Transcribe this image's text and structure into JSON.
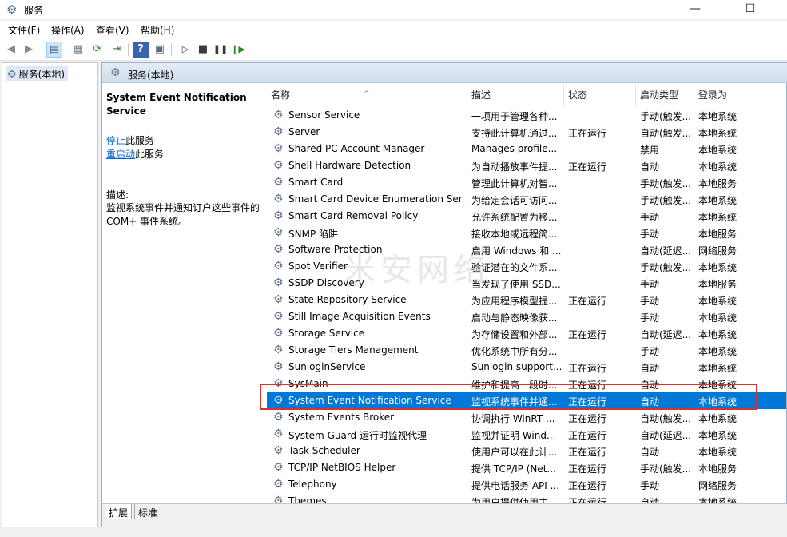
{
  "window": {
    "title": "服务",
    "minimize": "—",
    "maximize": "☐",
    "close": "✕"
  },
  "menu": [
    "文件(F)",
    "操作(A)",
    "查看(V)",
    "帮助(H)"
  ],
  "tree": {
    "label": "服务(本地)"
  },
  "main": {
    "header": "服务(本地)",
    "selected_title": "System Event Notification Service",
    "stop_link": "停止",
    "stop_suffix": "此服务",
    "restart_link": "重启动",
    "restart_suffix": "此服务",
    "desc_label": "描述:",
    "desc_text": "监视系统事件并通知订户这些事件的 COM+ 事件系统。"
  },
  "columns": {
    "name": "名称",
    "desc": "描述",
    "status": "状态",
    "start": "启动类型",
    "logon": "登录为"
  },
  "services": [
    {
      "name": "Sensor Service",
      "desc": "一项用于管理各种...",
      "status": "",
      "start": "手动(触发...",
      "logon": "本地系统"
    },
    {
      "name": "Server",
      "desc": "支持此计算机通过...",
      "status": "正在运行",
      "start": "自动(触发...",
      "logon": "本地系统"
    },
    {
      "name": "Shared PC Account Manager",
      "desc": "Manages profile...",
      "status": "",
      "start": "禁用",
      "logon": "本地系统"
    },
    {
      "name": "Shell Hardware Detection",
      "desc": "为自动播放事件提...",
      "status": "正在运行",
      "start": "自动",
      "logon": "本地系统"
    },
    {
      "name": "Smart Card",
      "desc": "管理此计算机对智...",
      "status": "",
      "start": "手动(触发...",
      "logon": "本地服务"
    },
    {
      "name": "Smart Card Device Enumeration Ser...",
      "desc": "为给定会话可访问...",
      "status": "",
      "start": "手动(触发...",
      "logon": "本地系统"
    },
    {
      "name": "Smart Card Removal Policy",
      "desc": "允许系统配置为移...",
      "status": "",
      "start": "手动",
      "logon": "本地系统"
    },
    {
      "name": "SNMP 陷阱",
      "desc": "接收本地或远程简...",
      "status": "",
      "start": "手动",
      "logon": "本地服务"
    },
    {
      "name": "Software Protection",
      "desc": "启用 Windows 和 ...",
      "status": "",
      "start": "自动(延迟...",
      "logon": "网络服务"
    },
    {
      "name": "Spot Verifier",
      "desc": "验证潜在的文件系...",
      "status": "",
      "start": "手动(触发...",
      "logon": "本地系统"
    },
    {
      "name": "SSDP Discovery",
      "desc": "当发现了使用 SSD...",
      "status": "",
      "start": "手动",
      "logon": "本地服务"
    },
    {
      "name": "State Repository Service",
      "desc": "为应用程序模型提...",
      "status": "正在运行",
      "start": "手动",
      "logon": "本地系统"
    },
    {
      "name": "Still Image Acquisition Events",
      "desc": "启动与静态映像获...",
      "status": "",
      "start": "手动",
      "logon": "本地系统"
    },
    {
      "name": "Storage Service",
      "desc": "为存储设置和外部...",
      "status": "正在运行",
      "start": "自动(延迟...",
      "logon": "本地系统"
    },
    {
      "name": "Storage Tiers Management",
      "desc": "优化系统中所有分...",
      "status": "",
      "start": "手动",
      "logon": "本地系统"
    },
    {
      "name": "SunloginService",
      "desc": "Sunlogin support...",
      "status": "正在运行",
      "start": "自动",
      "logon": "本地系统"
    },
    {
      "name": "SysMain",
      "desc": "维护和提高一段时...",
      "status": "正在运行",
      "start": "自动",
      "logon": "本地系统"
    },
    {
      "name": "System Event Notification Service",
      "desc": "监视系统事件并通...",
      "status": "正在运行",
      "start": "自动",
      "logon": "本地系统"
    },
    {
      "name": "System Events Broker",
      "desc": "协调执行 WinRT ...",
      "status": "正在运行",
      "start": "自动(触发...",
      "logon": "本地系统"
    },
    {
      "name": "System Guard 运行时监视代理",
      "desc": "监视并证明 Wind...",
      "status": "正在运行",
      "start": "自动(延迟...",
      "logon": "本地系统"
    },
    {
      "name": "Task Scheduler",
      "desc": "使用户可以在此计...",
      "status": "正在运行",
      "start": "自动",
      "logon": "本地系统"
    },
    {
      "name": "TCP/IP NetBIOS Helper",
      "desc": "提供 TCP/IP (Net...",
      "status": "正在运行",
      "start": "手动(触发...",
      "logon": "本地服务"
    },
    {
      "name": "Telephony",
      "desc": "提供电话服务 API ...",
      "status": "正在运行",
      "start": "手动",
      "logon": "网络服务"
    },
    {
      "name": "Themes",
      "desc": "为用户提供使用主...",
      "status": "正在运行",
      "start": "自动",
      "logon": "本地系统"
    }
  ],
  "selected_index": 17,
  "tabs": [
    "扩展",
    "标准"
  ],
  "watermark": "米安网络",
  "colors": {
    "selection": "#0078d7",
    "highlight_box": "#d9322e",
    "link": "#0066cc"
  }
}
